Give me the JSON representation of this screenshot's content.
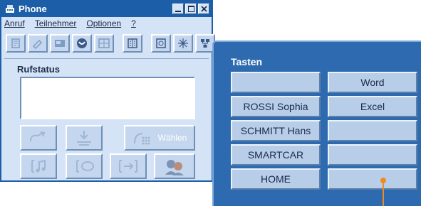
{
  "window": {
    "title": "Phone",
    "controls": [
      "minimize-icon",
      "maximize-icon",
      "close-icon"
    ]
  },
  "menu": {
    "items": [
      "Anruf",
      "Teilnehmer",
      "Optionen",
      "?"
    ]
  },
  "toolbar": {
    "icons": [
      "journal-icon",
      "phone-book-icon",
      "directory-icon",
      "call-icon",
      "conference-icon",
      "list-icon",
      "dial-icon",
      "settings-icon",
      "network-icon"
    ]
  },
  "status": {
    "label": "Rufstatus"
  },
  "actions": {
    "dial_label": "Wählen"
  },
  "tasten": {
    "title": "Tasten",
    "left": [
      "",
      "ROSSI Sophia",
      "SCHMITT Hans",
      "SMARTCAR",
      "HOME"
    ],
    "right": [
      "Word",
      "Excel",
      "",
      "",
      ""
    ]
  },
  "colors": {
    "accent": "#1c5fa8",
    "panel": "#2e6aaf",
    "callout": "#f28a1e"
  }
}
